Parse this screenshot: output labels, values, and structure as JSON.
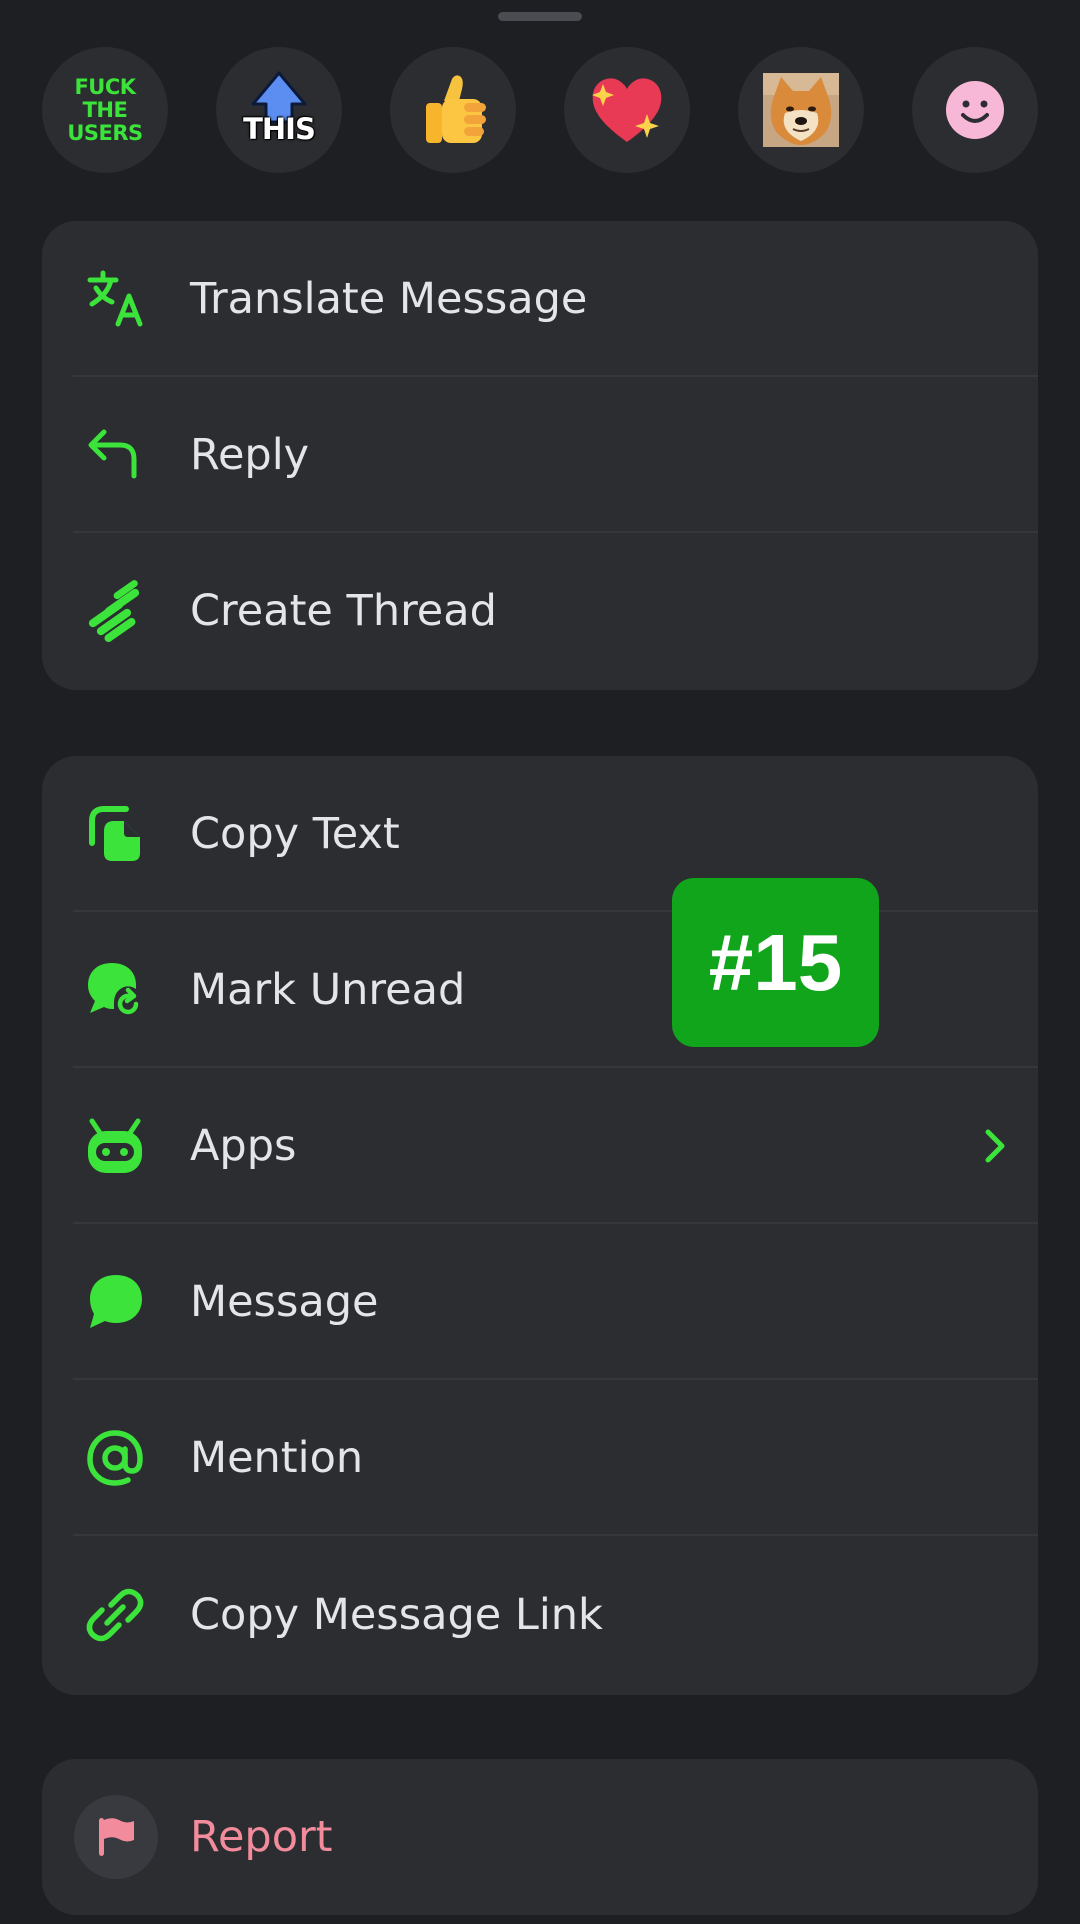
{
  "reactions": [
    {
      "name": "fuck-the-users-emoji",
      "text": [
        "FUCK",
        "THE",
        "USERS"
      ]
    },
    {
      "name": "this-upvote-emoji",
      "text": "THIS"
    },
    {
      "name": "thumbs-up-emoji"
    },
    {
      "name": "sparkling-heart-emoji"
    },
    {
      "name": "doge-emoji"
    },
    {
      "name": "smiling-face-emoji"
    }
  ],
  "group_primary": {
    "translate": "Translate Message",
    "reply": "Reply",
    "create_thread": "Create Thread"
  },
  "group_secondary": {
    "copy_text": "Copy Text",
    "mark_unread": "Mark Unread",
    "apps": "Apps",
    "message": "Message",
    "mention": "Mention",
    "copy_link": "Copy Message Link"
  },
  "group_danger": {
    "report": "Report"
  },
  "badge": "#15",
  "colors": {
    "icon_accent": "#3be33b",
    "report_accent": "#f28b9c",
    "badge_bg": "#11a51c",
    "surface": "#2b2d31",
    "background": "#1e1f22"
  }
}
